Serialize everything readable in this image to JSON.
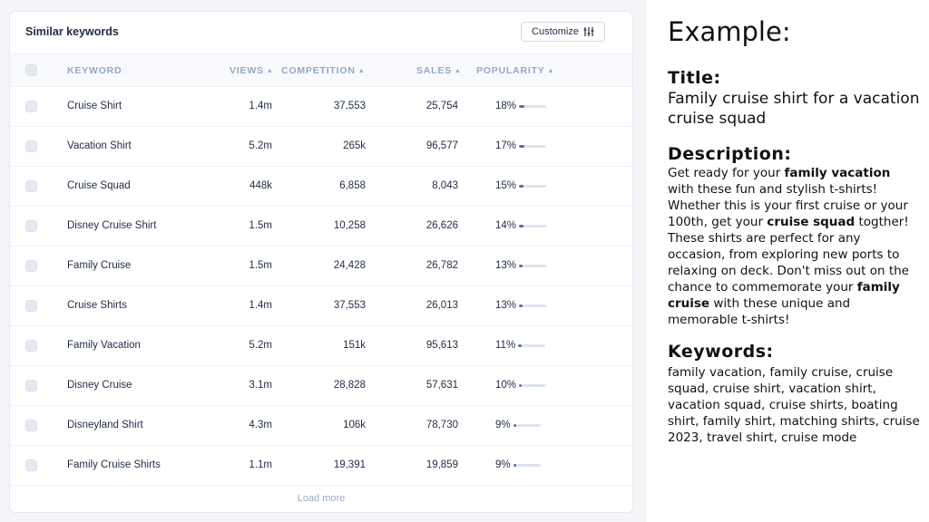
{
  "panel": {
    "title": "Similar keywords",
    "customize_label": "Customize",
    "load_more_label": "Load more"
  },
  "columns": {
    "keyword": "KEYWORD",
    "views": "VIEWS",
    "competition": "COMPETITION",
    "sales": "SALES",
    "popularity": "POPULARITY"
  },
  "rows": [
    {
      "keyword": "Cruise Shirt",
      "views": "1.4m",
      "competition": "37,553",
      "sales": "25,754",
      "popularity": "18%",
      "popularity_value": 18
    },
    {
      "keyword": "Vacation Shirt",
      "views": "5.2m",
      "competition": "265k",
      "sales": "96,577",
      "popularity": "17%",
      "popularity_value": 17
    },
    {
      "keyword": "Cruise Squad",
      "views": "448k",
      "competition": "6,858",
      "sales": "8,043",
      "popularity": "15%",
      "popularity_value": 15
    },
    {
      "keyword": "Disney Cruise Shirt",
      "views": "1.5m",
      "competition": "10,258",
      "sales": "26,626",
      "popularity": "14%",
      "popularity_value": 14
    },
    {
      "keyword": "Family Cruise",
      "views": "1.5m",
      "competition": "24,428",
      "sales": "26,782",
      "popularity": "13%",
      "popularity_value": 13
    },
    {
      "keyword": "Cruise Shirts",
      "views": "1.4m",
      "competition": "37,553",
      "sales": "26,013",
      "popularity": "13%",
      "popularity_value": 13
    },
    {
      "keyword": "Family Vacation",
      "views": "5.2m",
      "competition": "151k",
      "sales": "95,613",
      "popularity": "11%",
      "popularity_value": 11
    },
    {
      "keyword": "Disney Cruise",
      "views": "3.1m",
      "competition": "28,828",
      "sales": "57,631",
      "popularity": "10%",
      "popularity_value": 10
    },
    {
      "keyword": "Disneyland Shirt",
      "views": "4.3m",
      "competition": "106k",
      "sales": "78,730",
      "popularity": "9%",
      "popularity_value": 9
    },
    {
      "keyword": "Family Cruise Shirts",
      "views": "1.1m",
      "competition": "19,391",
      "sales": "19,859",
      "popularity": "9%",
      "popularity_value": 9
    }
  ],
  "example": {
    "heading": "Example:",
    "title_heading": "Title:",
    "title_text": "Family cruise shirt for a vacation cruise squad",
    "description_heading": "Description:",
    "description_parts": [
      {
        "text": "Get ready for your ",
        "bold": false
      },
      {
        "text": "family vacation",
        "bold": true
      },
      {
        "text": " with these fun and stylish t-shirts! Whether this is your first cruise or your 100th, get your ",
        "bold": false
      },
      {
        "text": "cruise squad",
        "bold": true
      },
      {
        "text": " togther! These shirts are perfect for any occasion, from exploring new ports to relaxing on deck. Don't miss out on the chance to commemorate your ",
        "bold": false
      },
      {
        "text": "family cruise",
        "bold": true
      },
      {
        "text": " with these unique and memorable t-shirts!",
        "bold": false
      }
    ],
    "keywords_heading": "Keywords:",
    "keywords_text": "family vacation, family cruise,  cruise squad, cruise shirt, vacation shirt, vacation squad, cruise shirts, boating shirt, family shirt, matching shirts, cruise 2023, travel shirt, cruise mode"
  },
  "colors": {
    "accent_bar": "#5b6f99",
    "header_text": "#96a6c8",
    "body_text": "#1e2b45"
  },
  "icons": {
    "customize": "sliders-icon",
    "sort": "sort-arrows-icon"
  }
}
